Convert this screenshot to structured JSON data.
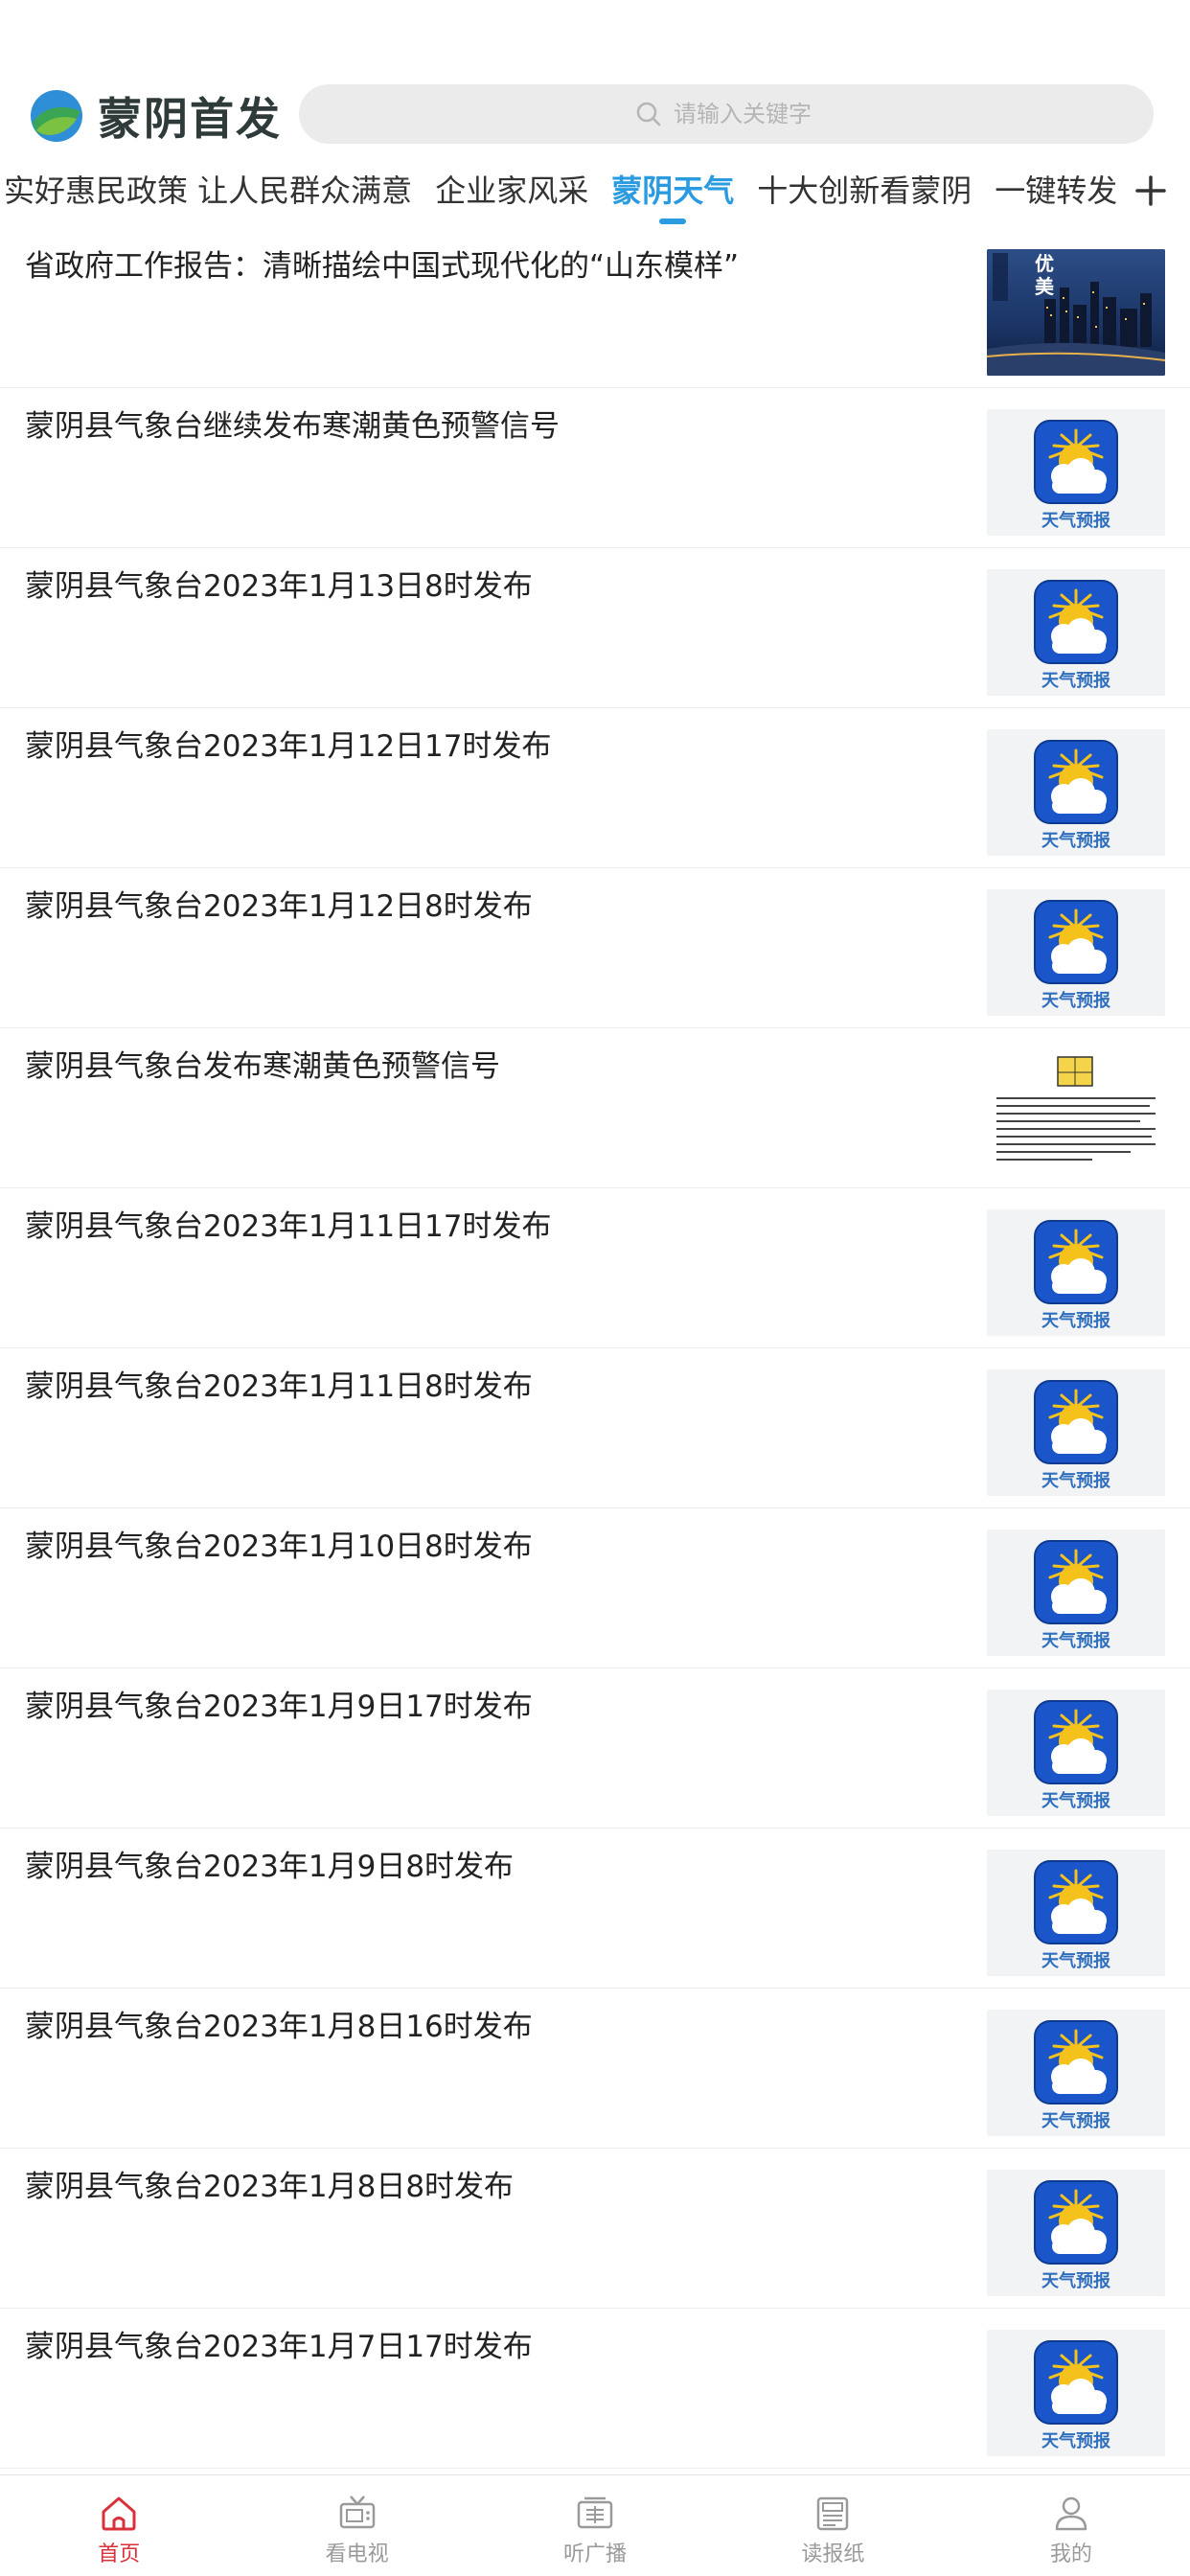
{
  "app": {
    "name": "蒙阴首发",
    "accent_color": "#2a9be0",
    "tabbar_active_color": "#d9303a"
  },
  "search": {
    "placeholder": "请输入关键字"
  },
  "tabs": [
    {
      "label": "实好惠民政策 让人民群众满意",
      "active": false
    },
    {
      "label": "企业家风采",
      "active": false
    },
    {
      "label": "蒙阴天气",
      "active": true
    },
    {
      "label": "十大创新看蒙阴",
      "active": false
    },
    {
      "label": "一键转发",
      "active": false
    }
  ],
  "tab_add_icon": "plus-icon",
  "articles": [
    {
      "title": "省政府工作报告：清晰描绘中国式现代化的“山东模样”",
      "thumb": "photo",
      "thumb_text": "优美"
    },
    {
      "title": "蒙阴县气象台继续发布寒潮黄色预警信号",
      "thumb": "weather",
      "thumb_text": "天气预报"
    },
    {
      "title": "蒙阴县气象台2023年1月13日8时发布",
      "thumb": "weather",
      "thumb_text": "天气预报"
    },
    {
      "title": "蒙阴县气象台2023年1月12日17时发布",
      "thumb": "weather",
      "thumb_text": "天气预报"
    },
    {
      "title": "蒙阴县气象台2023年1月12日8时发布",
      "thumb": "weather",
      "thumb_text": "天气预报"
    },
    {
      "title": "蒙阴县气象台发布寒潮黄色预警信号",
      "thumb": "doc",
      "thumb_text": ""
    },
    {
      "title": "蒙阴县气象台2023年1月11日17时发布",
      "thumb": "weather",
      "thumb_text": "天气预报"
    },
    {
      "title": "蒙阴县气象台2023年1月11日8时发布",
      "thumb": "weather",
      "thumb_text": "天气预报"
    },
    {
      "title": "蒙阴县气象台2023年1月10日8时发布",
      "thumb": "weather",
      "thumb_text": "天气预报"
    },
    {
      "title": "蒙阴县气象台2023年1月9日17时发布",
      "thumb": "weather",
      "thumb_text": "天气预报"
    },
    {
      "title": "蒙阴县气象台2023年1月9日8时发布",
      "thumb": "weather",
      "thumb_text": "天气预报"
    },
    {
      "title": "蒙阴县气象台2023年1月8日16时发布",
      "thumb": "weather",
      "thumb_text": "天气预报"
    },
    {
      "title": "蒙阴县气象台2023年1月8日8时发布",
      "thumb": "weather",
      "thumb_text": "天气预报"
    },
    {
      "title": "蒙阴县气象台2023年1月7日17时发布",
      "thumb": "weather",
      "thumb_text": "天气预报"
    }
  ],
  "tabbar": [
    {
      "label": "首页",
      "icon": "home-icon",
      "active": true
    },
    {
      "label": "看电视",
      "icon": "tv-icon",
      "active": false
    },
    {
      "label": "听广播",
      "icon": "radio-icon",
      "active": false
    },
    {
      "label": "读报纸",
      "icon": "newspaper-icon",
      "active": false
    },
    {
      "label": "我的",
      "icon": "user-icon",
      "active": false
    }
  ]
}
